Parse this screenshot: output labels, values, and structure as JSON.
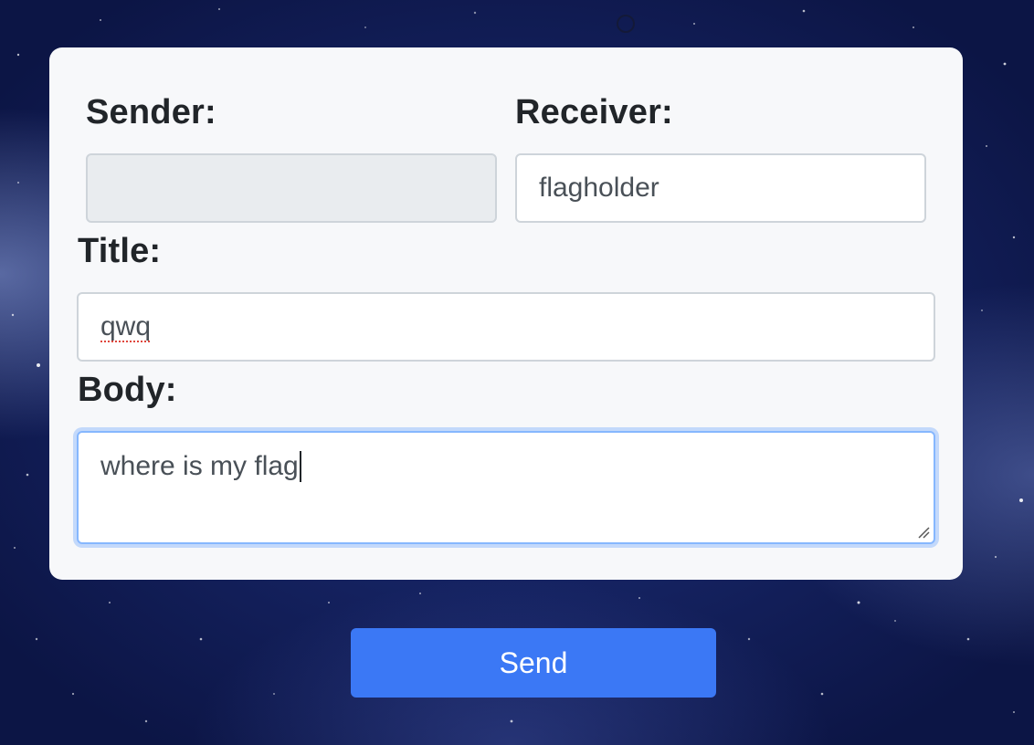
{
  "form": {
    "sender": {
      "label": "Sender:",
      "value": "",
      "disabled": true
    },
    "receiver": {
      "label": "Receiver:",
      "value": "flagholder"
    },
    "title": {
      "label": "Title:",
      "value": "qwq"
    },
    "body": {
      "label": "Body:",
      "value": "where is my flag"
    }
  },
  "send_button": {
    "label": "Send"
  },
  "colors": {
    "accent": "#3b78f5",
    "focus_border": "#86b7fe",
    "card_background": "#f7f8fa",
    "page_background": "#14215e"
  }
}
